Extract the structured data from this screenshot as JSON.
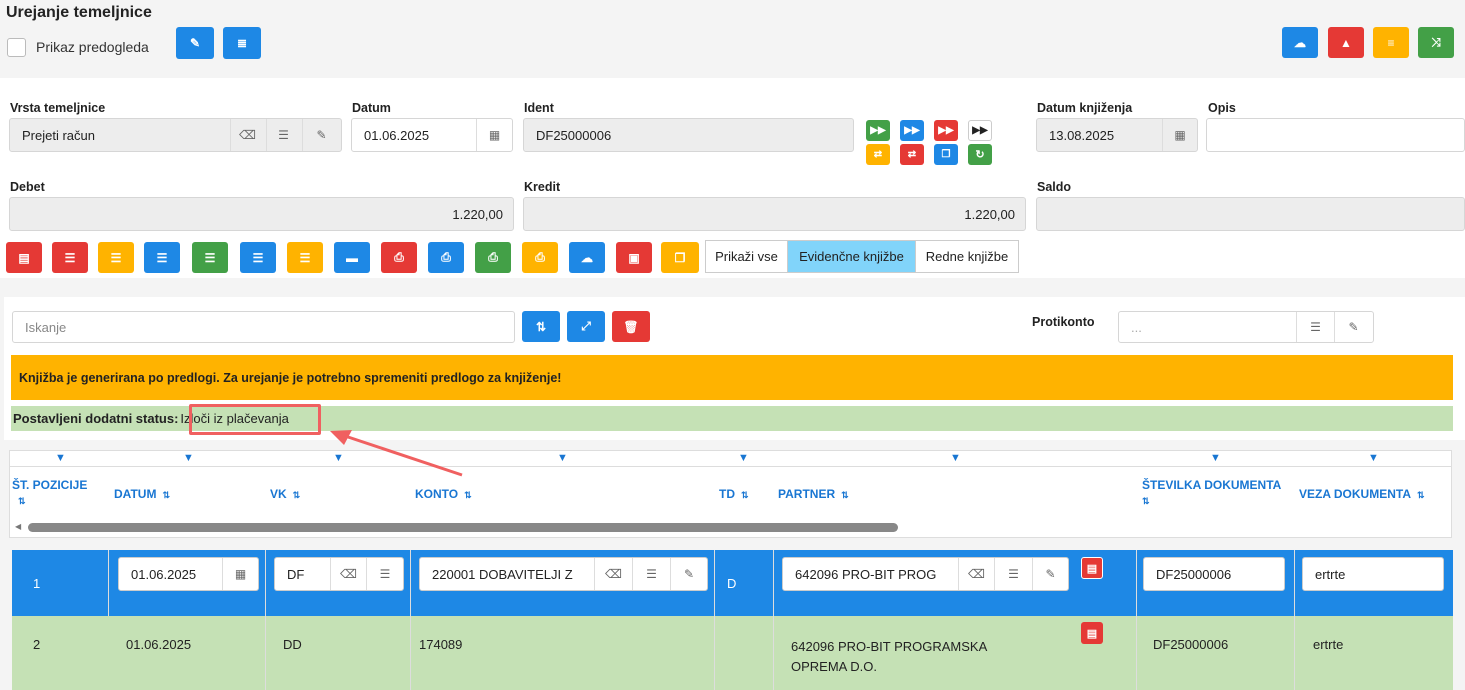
{
  "header": {
    "title": "Urejanje temeljnice",
    "preview_label": "Prikaz predogleda"
  },
  "form": {
    "vrsta_label": "Vrsta temeljnice",
    "vrsta_value": "Prejeti račun",
    "datum_label": "Datum",
    "datum_value": "01.06.2025",
    "ident_label": "Ident",
    "ident_value": "DF25000006",
    "datum_knjizenja_label": "Datum knjiženja",
    "datum_knjizenja_value": "13.08.2025",
    "opis_label": "Opis",
    "opis_value": "",
    "debet_label": "Debet",
    "debet_value": "1.220,00",
    "kredit_label": "Kredit",
    "kredit_value": "1.220,00",
    "saldo_label": "Saldo",
    "saldo_value": ""
  },
  "toolbar": {
    "prikazi_vse": "Prikaži vse",
    "evidencne": "Evidenčne knjižbe",
    "redne": "Redne knjižbe"
  },
  "search": {
    "placeholder": "Iskanje",
    "protikonto_label": "Protikonto",
    "protikonto_placeholder": "..."
  },
  "alert": {
    "warning": "Knjižba je generirana po predlogi. Za urejanje je potrebno spremeniti predlogo za knjiženje!",
    "status_label": "Postavljeni dodatni status:",
    "status_value": "Izloči iz plačevanja"
  },
  "table": {
    "headers": {
      "pozicija_1": "ŠT. POZICIJE",
      "datum": "DATUM",
      "vk": "VK",
      "konto": "KONTO",
      "td": "TD",
      "partner": "PARTNER",
      "stevilka": "ŠTEVILKA DOKUMENTA",
      "veza": "VEZA DOKUMENTA"
    },
    "rows": [
      {
        "poz": "1",
        "datum": "01.06.2025",
        "vk": "DF",
        "konto": "220001 DOBAVITELJI Z",
        "td": "D",
        "partner": "642096 PRO-BIT PROG",
        "stevilka": "DF25000006",
        "veza": "ertrte"
      },
      {
        "poz": "2",
        "datum": "01.06.2025",
        "vk": "DD",
        "konto": "174089",
        "td": "",
        "partner_1": "642096 PRO-BIT PROGRAMSKA",
        "partner_2": "OPREMA D.O.",
        "stevilka": "DF25000006",
        "veza": "ertrte"
      }
    ]
  },
  "colors": {
    "blue": "#1e88e5",
    "red": "#e53935",
    "orange": "#ffb300",
    "green": "#43a047",
    "row_selected": "#1e88e5",
    "row_green": "#c5e1b5",
    "annotation": "#f06060"
  }
}
